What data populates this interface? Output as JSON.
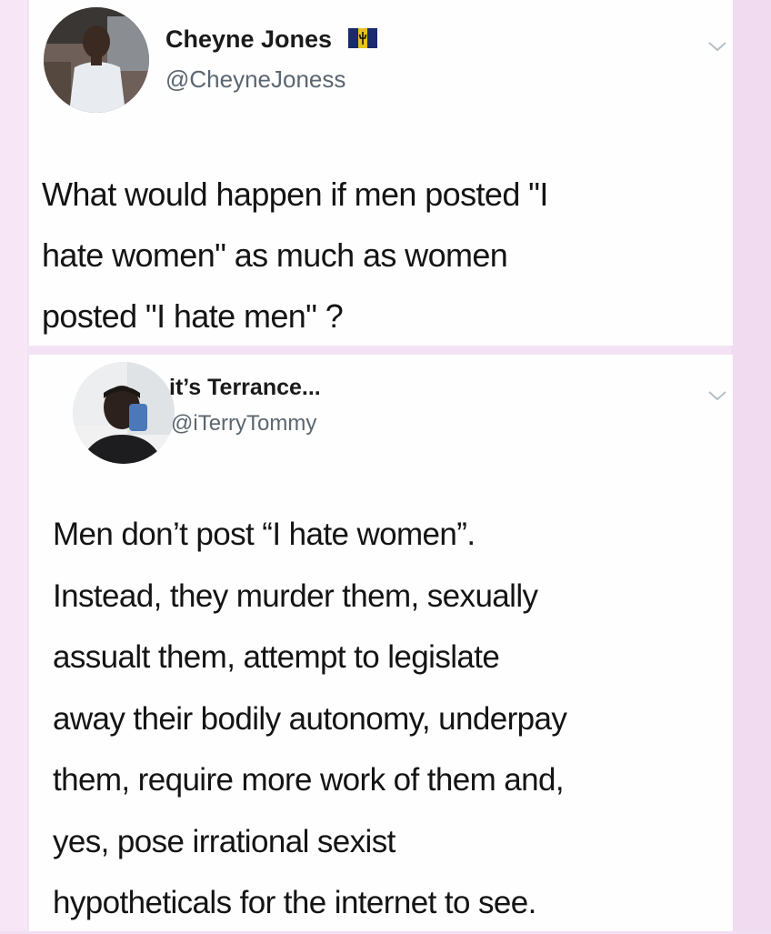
{
  "tweets": [
    {
      "author": {
        "display_name": "Cheyne Jones",
        "handle": "@CheyneJoness",
        "flag_icon": "barbados-flag-icon"
      },
      "text_lines": [
        "What would happen if men posted \"I",
        "hate women\" as much as women",
        "posted \"I hate men\" ?"
      ]
    },
    {
      "author": {
        "display_name": "it’s Terrance...",
        "handle": "@iTerryTommy"
      },
      "text_lines": [
        "Men don’t post “I hate women”.",
        "Instead, they murder them, sexually",
        "assualt them, attempt to legislate",
        "away their bodily autonomy, underpay",
        "them, require more work of them and,",
        "yes, pose irrational sexist",
        "hypotheticals for the internet to see."
      ]
    }
  ],
  "colors": {
    "background": "#f3e2f4",
    "card": "#fefefe",
    "text": "#141414",
    "handle": "#5b6670"
  }
}
